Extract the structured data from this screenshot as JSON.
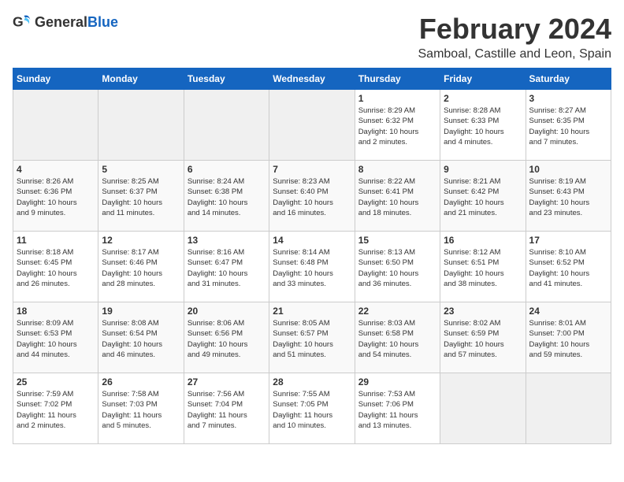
{
  "logo": {
    "general": "General",
    "blue": "Blue"
  },
  "title": "February 2024",
  "subtitle": "Samboal, Castille and Leon, Spain",
  "days_of_week": [
    "Sunday",
    "Monday",
    "Tuesday",
    "Wednesday",
    "Thursday",
    "Friday",
    "Saturday"
  ],
  "weeks": [
    [
      {
        "day": "",
        "info": ""
      },
      {
        "day": "",
        "info": ""
      },
      {
        "day": "",
        "info": ""
      },
      {
        "day": "",
        "info": ""
      },
      {
        "day": "1",
        "info": "Sunrise: 8:29 AM\nSunset: 6:32 PM\nDaylight: 10 hours\nand 2 minutes."
      },
      {
        "day": "2",
        "info": "Sunrise: 8:28 AM\nSunset: 6:33 PM\nDaylight: 10 hours\nand 4 minutes."
      },
      {
        "day": "3",
        "info": "Sunrise: 8:27 AM\nSunset: 6:35 PM\nDaylight: 10 hours\nand 7 minutes."
      }
    ],
    [
      {
        "day": "4",
        "info": "Sunrise: 8:26 AM\nSunset: 6:36 PM\nDaylight: 10 hours\nand 9 minutes."
      },
      {
        "day": "5",
        "info": "Sunrise: 8:25 AM\nSunset: 6:37 PM\nDaylight: 10 hours\nand 11 minutes."
      },
      {
        "day": "6",
        "info": "Sunrise: 8:24 AM\nSunset: 6:38 PM\nDaylight: 10 hours\nand 14 minutes."
      },
      {
        "day": "7",
        "info": "Sunrise: 8:23 AM\nSunset: 6:40 PM\nDaylight: 10 hours\nand 16 minutes."
      },
      {
        "day": "8",
        "info": "Sunrise: 8:22 AM\nSunset: 6:41 PM\nDaylight: 10 hours\nand 18 minutes."
      },
      {
        "day": "9",
        "info": "Sunrise: 8:21 AM\nSunset: 6:42 PM\nDaylight: 10 hours\nand 21 minutes."
      },
      {
        "day": "10",
        "info": "Sunrise: 8:19 AM\nSunset: 6:43 PM\nDaylight: 10 hours\nand 23 minutes."
      }
    ],
    [
      {
        "day": "11",
        "info": "Sunrise: 8:18 AM\nSunset: 6:45 PM\nDaylight: 10 hours\nand 26 minutes."
      },
      {
        "day": "12",
        "info": "Sunrise: 8:17 AM\nSunset: 6:46 PM\nDaylight: 10 hours\nand 28 minutes."
      },
      {
        "day": "13",
        "info": "Sunrise: 8:16 AM\nSunset: 6:47 PM\nDaylight: 10 hours\nand 31 minutes."
      },
      {
        "day": "14",
        "info": "Sunrise: 8:14 AM\nSunset: 6:48 PM\nDaylight: 10 hours\nand 33 minutes."
      },
      {
        "day": "15",
        "info": "Sunrise: 8:13 AM\nSunset: 6:50 PM\nDaylight: 10 hours\nand 36 minutes."
      },
      {
        "day": "16",
        "info": "Sunrise: 8:12 AM\nSunset: 6:51 PM\nDaylight: 10 hours\nand 38 minutes."
      },
      {
        "day": "17",
        "info": "Sunrise: 8:10 AM\nSunset: 6:52 PM\nDaylight: 10 hours\nand 41 minutes."
      }
    ],
    [
      {
        "day": "18",
        "info": "Sunrise: 8:09 AM\nSunset: 6:53 PM\nDaylight: 10 hours\nand 44 minutes."
      },
      {
        "day": "19",
        "info": "Sunrise: 8:08 AM\nSunset: 6:54 PM\nDaylight: 10 hours\nand 46 minutes."
      },
      {
        "day": "20",
        "info": "Sunrise: 8:06 AM\nSunset: 6:56 PM\nDaylight: 10 hours\nand 49 minutes."
      },
      {
        "day": "21",
        "info": "Sunrise: 8:05 AM\nSunset: 6:57 PM\nDaylight: 10 hours\nand 51 minutes."
      },
      {
        "day": "22",
        "info": "Sunrise: 8:03 AM\nSunset: 6:58 PM\nDaylight: 10 hours\nand 54 minutes."
      },
      {
        "day": "23",
        "info": "Sunrise: 8:02 AM\nSunset: 6:59 PM\nDaylight: 10 hours\nand 57 minutes."
      },
      {
        "day": "24",
        "info": "Sunrise: 8:01 AM\nSunset: 7:00 PM\nDaylight: 10 hours\nand 59 minutes."
      }
    ],
    [
      {
        "day": "25",
        "info": "Sunrise: 7:59 AM\nSunset: 7:02 PM\nDaylight: 11 hours\nand 2 minutes."
      },
      {
        "day": "26",
        "info": "Sunrise: 7:58 AM\nSunset: 7:03 PM\nDaylight: 11 hours\nand 5 minutes."
      },
      {
        "day": "27",
        "info": "Sunrise: 7:56 AM\nSunset: 7:04 PM\nDaylight: 11 hours\nand 7 minutes."
      },
      {
        "day": "28",
        "info": "Sunrise: 7:55 AM\nSunset: 7:05 PM\nDaylight: 11 hours\nand 10 minutes."
      },
      {
        "day": "29",
        "info": "Sunrise: 7:53 AM\nSunset: 7:06 PM\nDaylight: 11 hours\nand 13 minutes."
      },
      {
        "day": "",
        "info": ""
      },
      {
        "day": "",
        "info": ""
      }
    ]
  ]
}
